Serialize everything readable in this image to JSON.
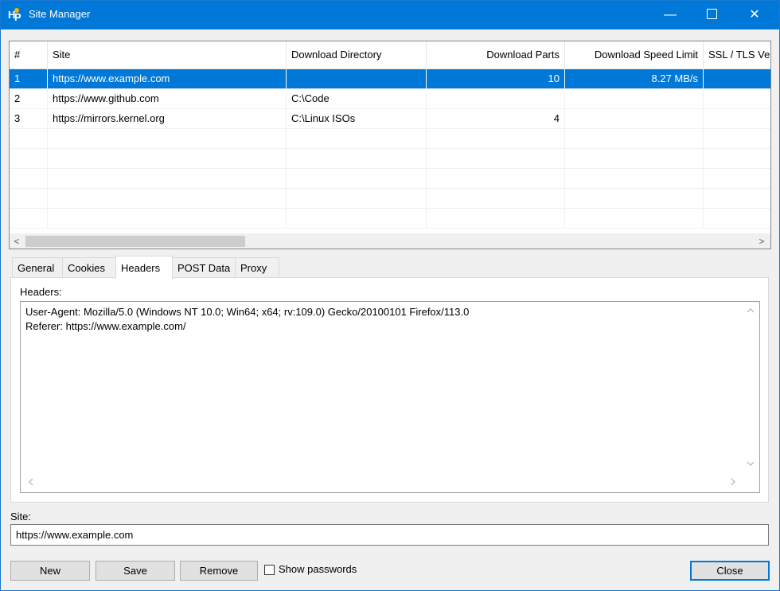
{
  "window": {
    "title": "Site Manager",
    "minimize_glyph": "—",
    "close_glyph": "✕"
  },
  "sites_table": {
    "columns": [
      {
        "key": "num",
        "label": "#"
      },
      {
        "key": "site",
        "label": "Site"
      },
      {
        "key": "dir",
        "label": "Download Directory"
      },
      {
        "key": "parts",
        "label": "Download Parts"
      },
      {
        "key": "speed",
        "label": "Download Speed Limit"
      },
      {
        "key": "ssl",
        "label": "SSL / TLS Ve"
      }
    ],
    "rows": [
      {
        "num": "1",
        "site": "https://www.example.com",
        "dir": "",
        "parts": "10",
        "speed": "8.27 MB/s",
        "ssl": "",
        "selected": true
      },
      {
        "num": "2",
        "site": "https://www.github.com",
        "dir": "C:\\Code",
        "parts": "",
        "speed": "",
        "ssl": "",
        "selected": false
      },
      {
        "num": "3",
        "site": "https://mirrors.kernel.org",
        "dir": "C:\\Linux ISOs",
        "parts": "4",
        "speed": "",
        "ssl": "",
        "selected": false
      }
    ],
    "scroll_left_glyph": "<",
    "scroll_right_glyph": ">"
  },
  "tabs": [
    {
      "label": "General",
      "active": false
    },
    {
      "label": "Cookies",
      "active": false
    },
    {
      "label": "Headers",
      "active": true
    },
    {
      "label": "POST Data",
      "active": false
    },
    {
      "label": "Proxy",
      "active": false
    }
  ],
  "headers_panel": {
    "label": "Headers:",
    "value": "User-Agent: Mozilla/5.0 (Windows NT 10.0; Win64; x64; rv:109.0) Gecko/20100101 Firefox/113.0\nReferer: https://www.example.com/"
  },
  "site_field": {
    "label": "Site:",
    "value": "https://www.example.com"
  },
  "buttons": {
    "new": "New",
    "save": "Save",
    "remove": "Remove",
    "show_passwords": "Show passwords",
    "close": "Close"
  },
  "colors": {
    "accent": "#0078d7",
    "title_bar": "#0078d7",
    "selected_row": "#0078d7"
  }
}
